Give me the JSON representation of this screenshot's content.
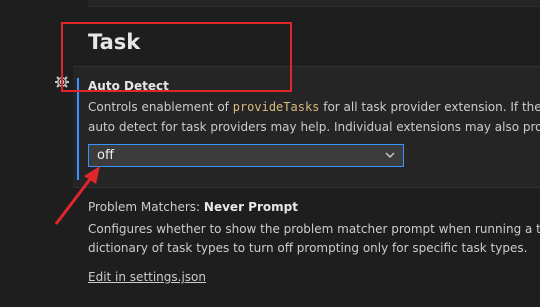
{
  "section": {
    "title": "Task"
  },
  "auto_detect": {
    "title": "Auto Detect",
    "desc_before": "Controls enablement of ",
    "desc_code": "provideTasks",
    "desc_after": " for all task provider extension. If the Tas",
    "desc_line2": "auto detect for task providers may help. Individual extensions may also provide",
    "value": "off"
  },
  "problem_matchers": {
    "title_prefix": "Problem Matchers: ",
    "title_bold": "Never Prompt",
    "desc_line1": "Configures whether to show the problem matcher prompt when running a task",
    "desc_line2": "dictionary of task types to turn off prompting only for specific task types."
  },
  "link": {
    "label": "Edit in settings.json"
  },
  "colors": {
    "accent": "#3794ff",
    "annotation": "#e0262b",
    "code": "#d7ba7d"
  },
  "icons": {
    "gear": "gear-icon",
    "chevron": "chevron-down-icon"
  }
}
